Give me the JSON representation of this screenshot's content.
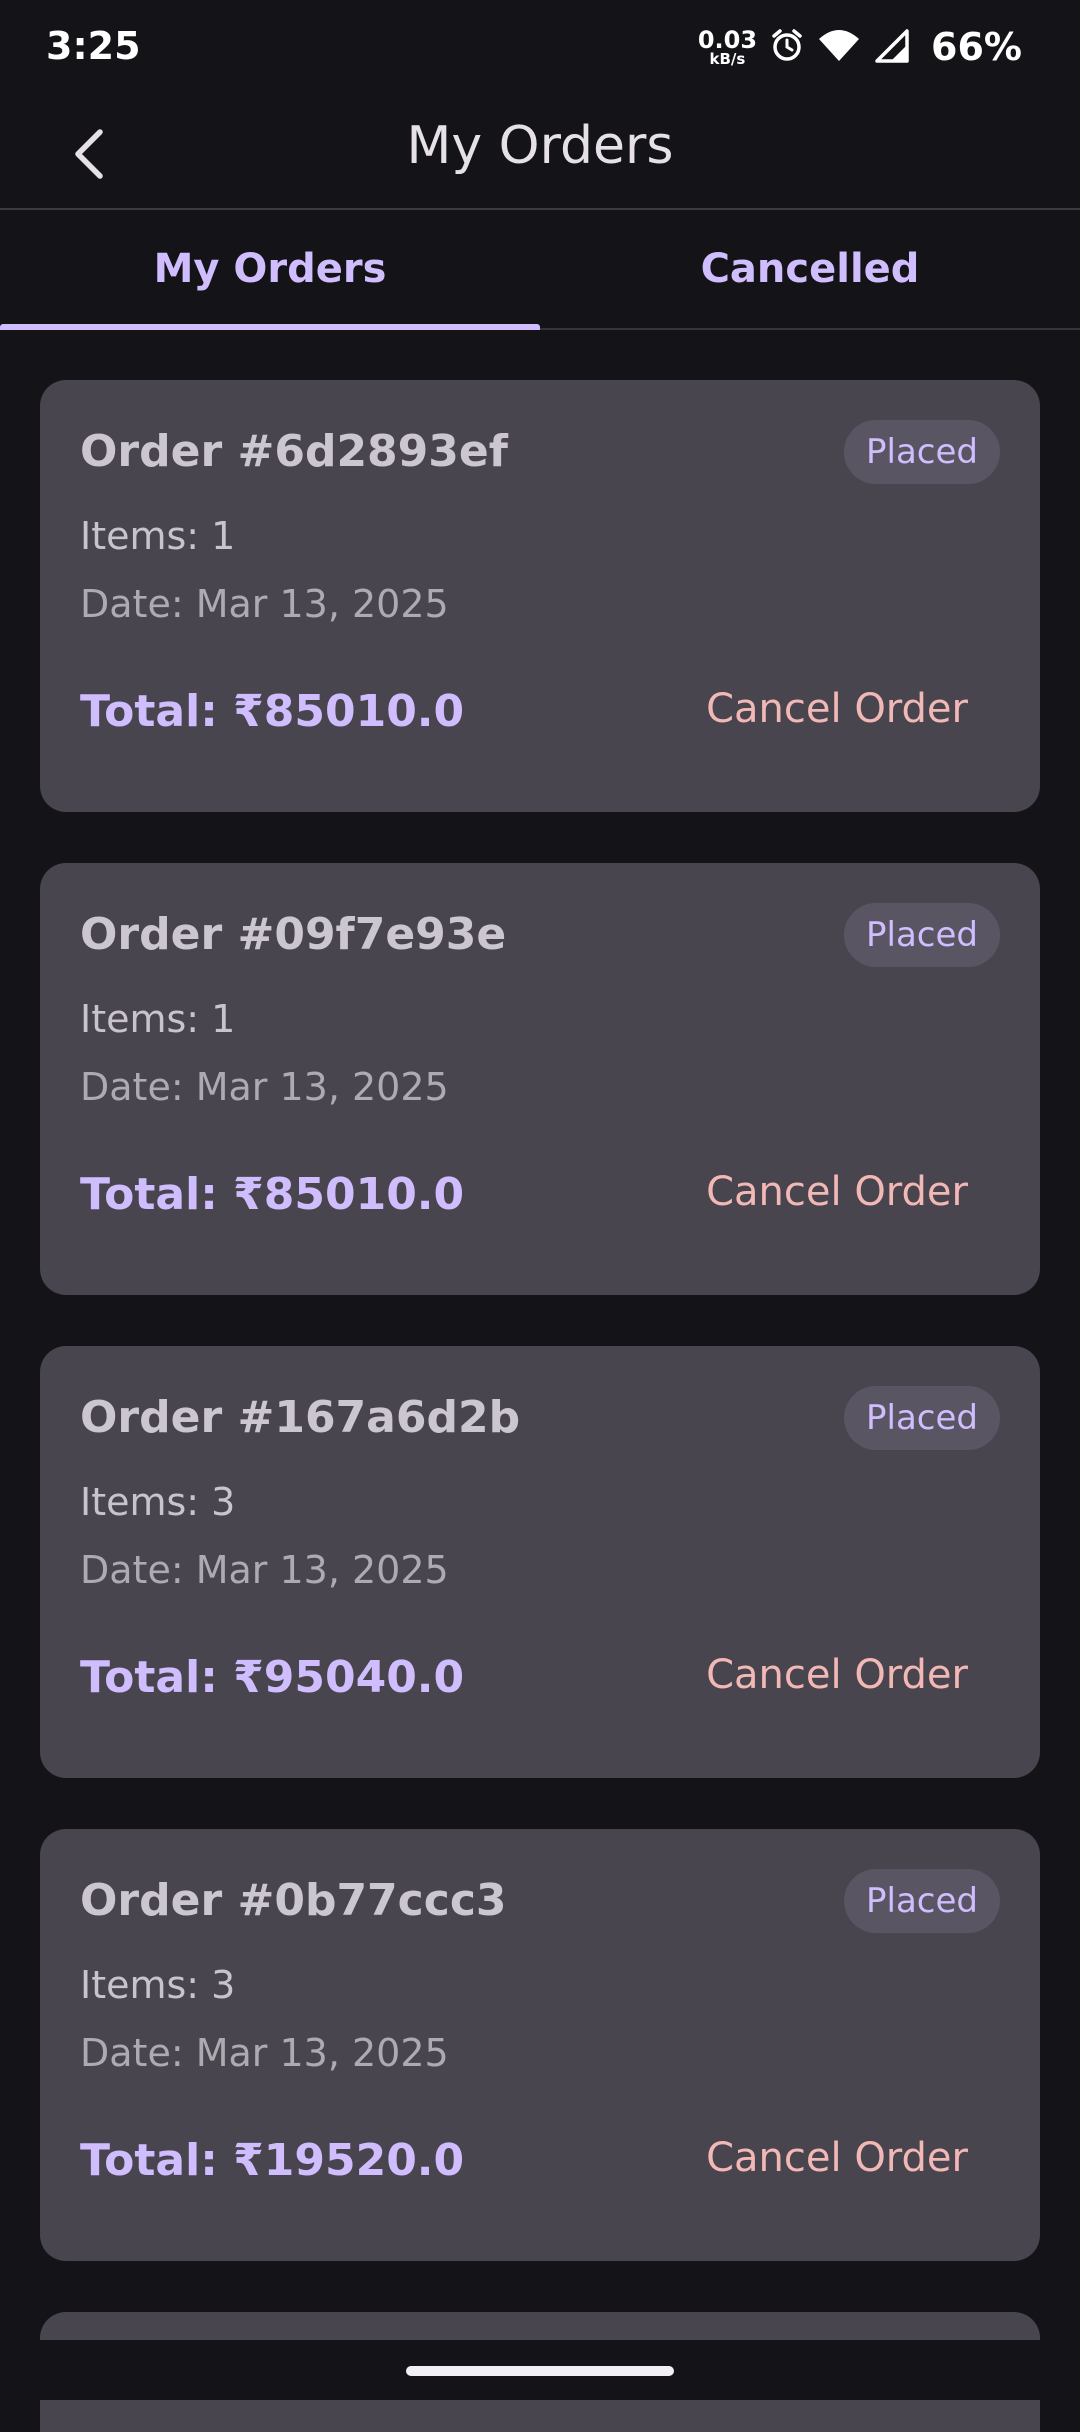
{
  "status_bar": {
    "time": "3:25",
    "net_speed_value": "0.03",
    "net_speed_unit": "kB/s",
    "battery": "66%",
    "icons": [
      "alarm-icon",
      "wifi-icon",
      "signal-icon"
    ]
  },
  "app_bar": {
    "title": "My Orders",
    "back_icon": "chevron-left-icon"
  },
  "tabs": [
    {
      "label": "My Orders",
      "active": true
    },
    {
      "label": "Cancelled",
      "active": false
    }
  ],
  "orders": [
    {
      "id": "Order #6d2893ef",
      "status": "Placed",
      "items": "Items: 1",
      "date": "Date: Mar 13, 2025",
      "total": "Total: ₹85010.0",
      "action": "Cancel Order"
    },
    {
      "id": "Order #09f7e93e",
      "status": "Placed",
      "items": "Items: 1",
      "date": "Date: Mar 13, 2025",
      "total": "Total: ₹85010.0",
      "action": "Cancel Order"
    },
    {
      "id": "Order #167a6d2b",
      "status": "Placed",
      "items": "Items: 3",
      "date": "Date: Mar 13, 2025",
      "total": "Total: ₹95040.0",
      "action": "Cancel Order"
    },
    {
      "id": "Order #0b77ccc3",
      "status": "Placed",
      "items": "Items: 3",
      "date": "Date: Mar 13, 2025",
      "total": "Total: ₹19520.0",
      "action": "Cancel Order"
    }
  ],
  "colors": {
    "background": "#141318",
    "card": "#49454f",
    "accent": "#cfbdfe",
    "cancel": "#f2b8b5"
  }
}
